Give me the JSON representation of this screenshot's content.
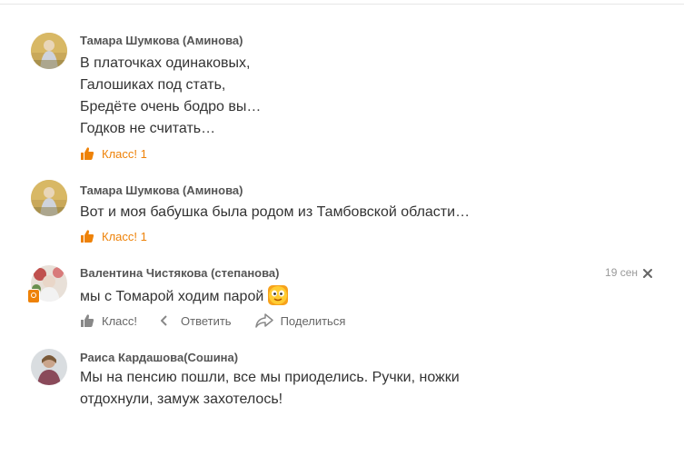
{
  "comments": [
    {
      "author": "Тамара Шумкова (Аминова)",
      "lines": [
        "В платочках одинаковых,",
        "Галошиках под стать,",
        "Бредёте очень бодро вы…",
        "Годков не считать…"
      ],
      "class_label": "Класс! 1"
    },
    {
      "author": "Тамара Шумкова (Аминова)",
      "lines": [
        "Вот и моя бабушка была родом из Тамбовской области…"
      ],
      "class_label": "Класс! 1"
    },
    {
      "author": "Валентина Чистякова (степанова)",
      "lines": [
        "мы с Томарой ходим парой"
      ],
      "time": "19 сен",
      "class_label": "Класс!",
      "reply_label": "Ответить",
      "share_label": "Поделиться"
    },
    {
      "author": "Раиса Кардашова(Сошина)",
      "lines": [
        "Мы на пенсию пошли, все мы приоделись. Ручки, ножки",
        "отдохнули, замуж захотелось!"
      ]
    }
  ],
  "icons": {
    "class": "thumbs-up-icon",
    "reply": "reply-arrow-icon",
    "share": "share-arrow-icon",
    "close": "close-icon",
    "emoji": "smiley-emoji-icon",
    "online": "ok-online-badge-icon"
  },
  "colors": {
    "accent": "#ee8208",
    "name": "#555555",
    "text": "#333333",
    "muted": "#666666",
    "time": "#999999"
  }
}
